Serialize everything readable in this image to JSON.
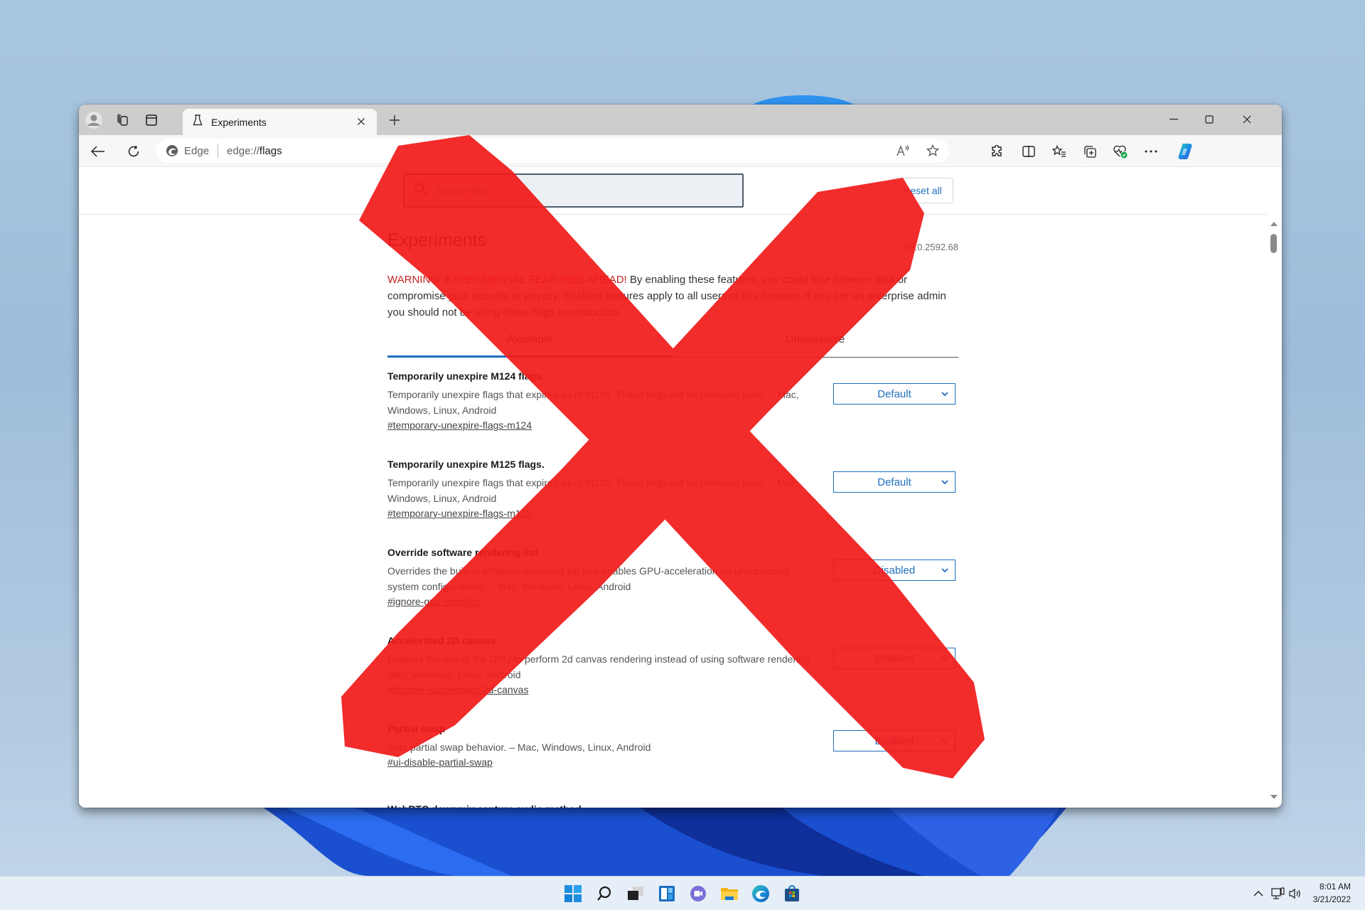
{
  "browser": {
    "tab": {
      "title": "Experiments",
      "icon": "flask-icon"
    },
    "omnibox": {
      "site_label": "Edge",
      "url_prefix": "edge://",
      "url_path": "flags"
    },
    "toolbar_icons": [
      "read-aloud-icon",
      "favorite-star-icon",
      "extensions-icon",
      "split-screen-icon",
      "favorites-icon",
      "collections-icon",
      "browser-essentials-icon",
      "more-icon",
      "copilot-icon"
    ]
  },
  "flags_page": {
    "search_placeholder": "Search flags",
    "reset_all_label": "Reset all",
    "title": "Experiments",
    "version": "126.0.2592.68",
    "warning_lead": "WARNING: EXPERIMENTAL FEATURES AHEAD!",
    "warning_body": " By enabling these features, you could lose browser data or compromise your security or privacy. Enabled features apply to all users of this browser. If you are an enterprise admin you should not be using these flags in production.",
    "tabs": [
      {
        "label": "Available",
        "active": true
      },
      {
        "label": "Unavailable",
        "active": false
      }
    ],
    "flags": [
      {
        "title": "Temporarily unexpire M124 flags.",
        "description": "Temporarily unexpire flags that expired as of M124. These flags will be removed soon. – Mac, Windows, Linux, Android",
        "anchor": "#temporary-unexpire-flags-m124",
        "value": "Default"
      },
      {
        "title": "Temporarily unexpire M125 flags.",
        "description": "Temporarily unexpire flags that expired as of M125. These flags will be removed soon. – Mac, Windows, Linux, Android",
        "anchor": "#temporary-unexpire-flags-m125",
        "value": "Default"
      },
      {
        "title": "Override software rendering list",
        "description": "Overrides the built-in software rendering list and enables GPU-acceleration on unsupported system configurations. – Mac, Windows, Linux, Android",
        "anchor": "#ignore-gpu-blocklist",
        "value": "Disabled"
      },
      {
        "title": "Accelerated 2D canvas",
        "description": "Enables the use of the GPU to perform 2d canvas rendering instead of using software rendering. – Mac, Windows, Linux, Android",
        "anchor": "#disable-accelerated-2d-canvas",
        "value": "Enabled"
      },
      {
        "title": "Partial swap",
        "description": "Sets partial swap behavior. – Mac, Windows, Linux, Android",
        "anchor": "#ui-disable-partial-swap",
        "value": "Enabled"
      }
    ],
    "partially_visible_flag_title": "WebRTC downmix capture audio method"
  },
  "overlay": {
    "type": "red-x-mark",
    "color": "#f21b1b"
  },
  "taskbar": {
    "apps": [
      "start-icon",
      "search-icon",
      "task-view-icon",
      "widgets-icon",
      "teams-chat-icon",
      "file-explorer-icon",
      "edge-icon",
      "store-icon"
    ],
    "time": "8:01 AM",
    "date": "3/21/2022"
  }
}
